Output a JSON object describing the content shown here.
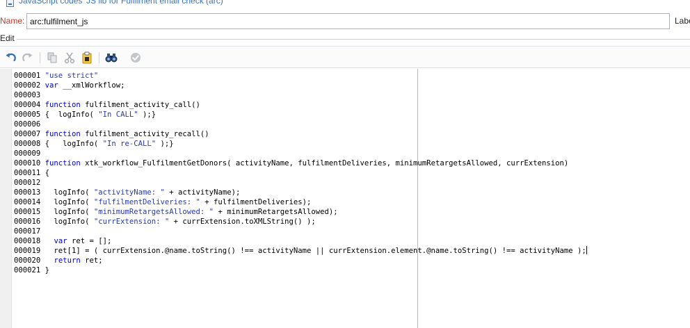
{
  "window": {
    "title": "JavaScript codes 'JS lib for Fulfilment email check (arc)'"
  },
  "form": {
    "name_label": "Name:",
    "name_value": "arc:fulfilment_js",
    "label_cut": "Labe",
    "edit_label": "Edit"
  },
  "toolbar": {
    "undo_icon": "undo-icon",
    "redo_icon": "redo-icon",
    "copy_icon": "copy-icon",
    "cut_icon": "cut-icon",
    "paste_icon": "paste-icon",
    "find_icon": "binoculars-icon",
    "check_icon": "check-icon"
  },
  "colors": {
    "keyword": "#0000c8",
    "string": "#2b3ba6",
    "name_label": "#c0392b",
    "title": "#3b73b7"
  },
  "code": {
    "lines": [
      {
        "num": "000001",
        "tokens": [
          {
            "t": "str",
            "v": "\"use strict\""
          }
        ]
      },
      {
        "num": "000002",
        "tokens": [
          {
            "t": "kw",
            "v": "var"
          },
          {
            "t": "tx",
            "v": " __xmlWorkflow;"
          }
        ]
      },
      {
        "num": "000003",
        "tokens": []
      },
      {
        "num": "000004",
        "tokens": [
          {
            "t": "kw",
            "v": "function"
          },
          {
            "t": "tx",
            "v": " fulfilment_activity_call()"
          }
        ]
      },
      {
        "num": "000005",
        "tokens": [
          {
            "t": "tx",
            "v": "{  logInfo( "
          },
          {
            "t": "str",
            "v": "\"In CALL\""
          },
          {
            "t": "tx",
            "v": " );}"
          }
        ]
      },
      {
        "num": "000006",
        "tokens": []
      },
      {
        "num": "000007",
        "tokens": [
          {
            "t": "kw",
            "v": "function"
          },
          {
            "t": "tx",
            "v": " fulfilment_activity_recall()"
          }
        ]
      },
      {
        "num": "000008",
        "tokens": [
          {
            "t": "tx",
            "v": "{   logInfo( "
          },
          {
            "t": "str",
            "v": "\"In re-CALL\""
          },
          {
            "t": "tx",
            "v": " );}"
          }
        ]
      },
      {
        "num": "000009",
        "tokens": []
      },
      {
        "num": "000010",
        "tokens": [
          {
            "t": "kw",
            "v": "function"
          },
          {
            "t": "tx",
            "v": " xtk_workflow_FulfilmentGetDonors( activityName, fulfilmentDeliveries, minimumRetargetsAllowed, currExtension)"
          }
        ]
      },
      {
        "num": "000011",
        "tokens": [
          {
            "t": "tx",
            "v": "{"
          }
        ]
      },
      {
        "num": "000012",
        "tokens": []
      },
      {
        "num": "000013",
        "tokens": [
          {
            "t": "tx",
            "v": "  logInfo( "
          },
          {
            "t": "str",
            "v": "\"activityName: \""
          },
          {
            "t": "tx",
            "v": " + activityName);"
          }
        ]
      },
      {
        "num": "000014",
        "tokens": [
          {
            "t": "tx",
            "v": "  logInfo( "
          },
          {
            "t": "str",
            "v": "\"fulfilmentDeliveries: \""
          },
          {
            "t": "tx",
            "v": " + fulfilmentDeliveries);"
          }
        ]
      },
      {
        "num": "000015",
        "tokens": [
          {
            "t": "tx",
            "v": "  logInfo( "
          },
          {
            "t": "str",
            "v": "\"minimumRetargetsAllowed: \""
          },
          {
            "t": "tx",
            "v": " + minimumRetargetsAllowed);"
          }
        ]
      },
      {
        "num": "000016",
        "tokens": [
          {
            "t": "tx",
            "v": "  logInfo( "
          },
          {
            "t": "str",
            "v": "\"currExtension: \""
          },
          {
            "t": "tx",
            "v": " + currExtension.toXMLString() );"
          }
        ]
      },
      {
        "num": "000017",
        "tokens": []
      },
      {
        "num": "000018",
        "tokens": [
          {
            "t": "tx",
            "v": "  "
          },
          {
            "t": "kw",
            "v": "var"
          },
          {
            "t": "tx",
            "v": " ret = [];"
          }
        ]
      },
      {
        "num": "000019",
        "tokens": [
          {
            "t": "tx",
            "v": "  ret[1] = ( currExtension.@name.toString() !== activityName || currExtension.element.@name.toString() !== activityName );"
          }
        ],
        "caret": true
      },
      {
        "num": "000020",
        "tokens": [
          {
            "t": "tx",
            "v": "  "
          },
          {
            "t": "kw",
            "v": "return"
          },
          {
            "t": "tx",
            "v": " ret;"
          }
        ]
      },
      {
        "num": "000021",
        "tokens": [
          {
            "t": "tx",
            "v": "}"
          }
        ]
      }
    ]
  }
}
